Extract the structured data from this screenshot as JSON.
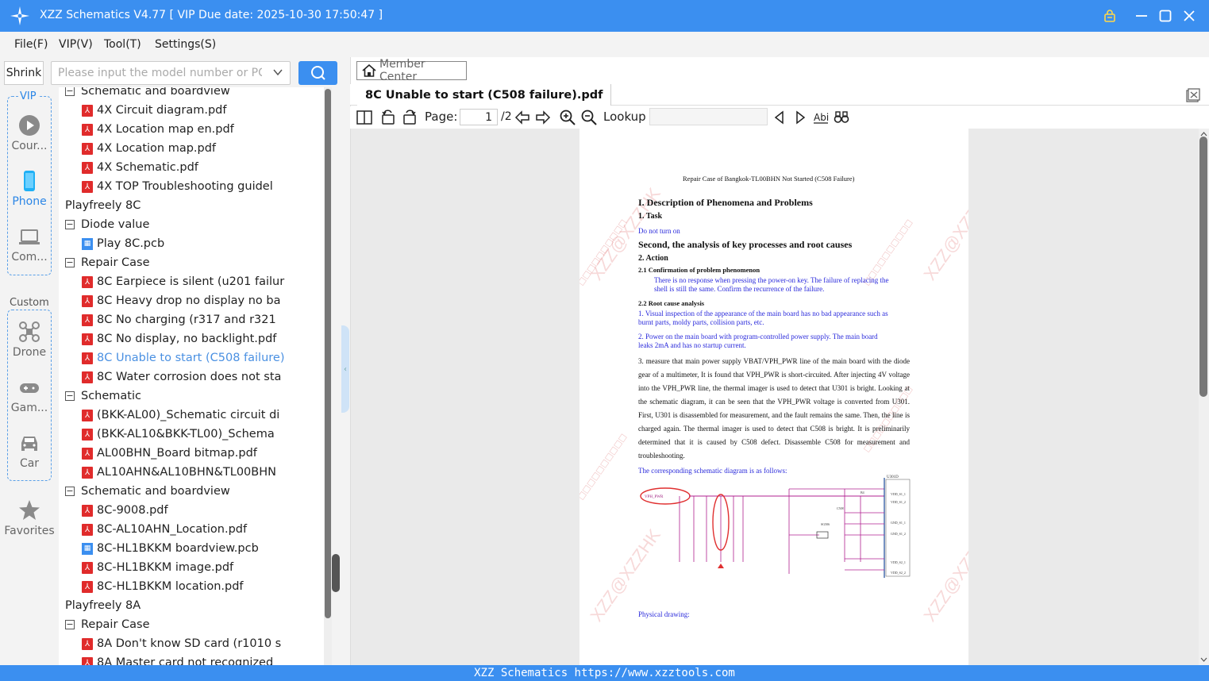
{
  "window": {
    "title": "XZZ Schematics V4.77 [ VIP Due date: 2025-10-30 17:50:47 ]"
  },
  "menu": [
    "File(F)",
    "VIP(V)",
    "Tool(T)",
    "Settings(S)"
  ],
  "search": {
    "shrink_label": "Shrink",
    "placeholder": "Please input the model number or PCB"
  },
  "sidebar": {
    "vip_label": "VIP",
    "custom_label": "Custom",
    "items": [
      "Cour...",
      "Phone",
      "Com...",
      "Drone",
      "Gam...",
      "Car",
      "Favorites"
    ]
  },
  "tree": [
    {
      "label": "Schematic and boardview",
      "kind": "folder"
    },
    {
      "label": "4X Circuit diagram.pdf",
      "kind": "pdf"
    },
    {
      "label": "4X Location map en.pdf",
      "kind": "pdf"
    },
    {
      "label": "4X Location map.pdf",
      "kind": "pdf"
    },
    {
      "label": "4X Schematic.pdf",
      "kind": "pdf"
    },
    {
      "label": "4X TOP Troubleshooting guidel",
      "kind": "pdf"
    },
    {
      "label": "Playfreely 8C",
      "kind": "group"
    },
    {
      "label": "Diode value",
      "kind": "folder"
    },
    {
      "label": "Play 8C.pcb",
      "kind": "pcb"
    },
    {
      "label": "Repair Case",
      "kind": "folder"
    },
    {
      "label": "8C Earpiece is silent (u201 failur",
      "kind": "pdf"
    },
    {
      "label": "8C Heavy drop no display no ba",
      "kind": "pdf"
    },
    {
      "label": "8C No charging (r317 and r321",
      "kind": "pdf"
    },
    {
      "label": "8C No display, no backlight.pdf",
      "kind": "pdf"
    },
    {
      "label": "8C Unable to start (C508 failure)",
      "kind": "pdf",
      "active": true
    },
    {
      "label": "8C Water corrosion does not sta",
      "kind": "pdf"
    },
    {
      "label": "Schematic",
      "kind": "folder"
    },
    {
      "label": "(BKK-AL00)_Schematic circuit di",
      "kind": "pdf"
    },
    {
      "label": "(BKK-AL10&BKK-TL00)_Schema",
      "kind": "pdf"
    },
    {
      "label": "AL00BHN_Board bitmap.pdf",
      "kind": "pdf"
    },
    {
      "label": "AL10AHN&AL10BHN&TL00BHN",
      "kind": "pdf"
    },
    {
      "label": "Schematic and boardview",
      "kind": "folder"
    },
    {
      "label": "8C-9008.pdf",
      "kind": "pdf"
    },
    {
      "label": "8C-AL10AHN_Location.pdf",
      "kind": "pdf"
    },
    {
      "label": "8C-HL1BKKM boardview.pcb",
      "kind": "pcb"
    },
    {
      "label": "8C-HL1BKKM image.pdf",
      "kind": "pdf"
    },
    {
      "label": "8C-HL1BKKM location.pdf",
      "kind": "pdf"
    },
    {
      "label": "Playfreely 8A",
      "kind": "group"
    },
    {
      "label": "Repair Case",
      "kind": "folder"
    },
    {
      "label": "8A Don't know SD card (r1010 s",
      "kind": "pdf"
    },
    {
      "label": "8A Master card not recognized",
      "kind": "pdf"
    }
  ],
  "viewer": {
    "member_center": "Member Center",
    "tab_title": "8C Unable to start (C508 failure).pdf",
    "page_label": "Page:",
    "page_current": "1",
    "page_total": "/2",
    "lookup_label": "Lookup"
  },
  "document": {
    "header": "Repair Case of Bangkok-TL00BHN Not Started (C508 Failure)",
    "h1": "I. Description of Phenomena and Problems",
    "task": "1. Task",
    "task_text": "Do not turn on",
    "h2": "Second, the analysis of key processes and root causes",
    "action": "2. Action",
    "s21": "2.1 Confirmation of problem phenomenon",
    "s21_text_1": "There is no response when pressing the power-on key. The failure of replacing the",
    "s21_text_2": "shell is still the same. Confirm the recurrence of the failure.",
    "s22": "2.2   Root cause analysis",
    "p1a": "1. Visual inspection of the appearance of the main board has no bad appearance such as",
    "p1b": "burnt parts, moldy parts, collision parts, etc.",
    "p2a": "2. Power on the main board with program-controlled power supply. The main board",
    "p2b": "leaks 2mA and has no startup current.",
    "p3": "3. measure that main power supply VBAT/VPH_PWR line of the main board with the diode gear of a multimeter, It is found that VPH_PWR is short-circuited. After injecting 4V voltage into the VPH_PWR line, the thermal imager is used to detect that U301 is bright. Looking at the schematic diagram, it can be seen that the VPH_PWR voltage is converted from U301. First, U301 is disassembled for measurement, and the fault remains the same. Then, the line is charged again. The thermal imager is used to detect that C508 is bright. It is preliminarily determined that it is caused by C508 defect. Disassemble C508 for measurement and troubleshooting.",
    "schematic_caption": "The corresponding schematic diagram is as follows:",
    "physical": "Physical drawing:",
    "watermark": "XZZ@XZZHK"
  },
  "status": "XZZ Schematics https://www.xzztools.com"
}
